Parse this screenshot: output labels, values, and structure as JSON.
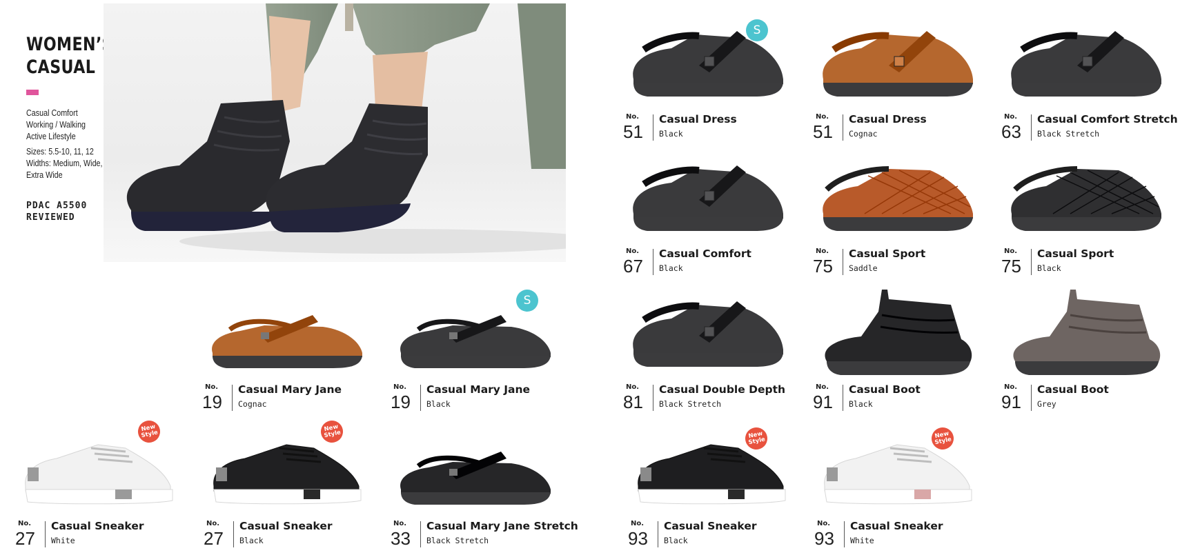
{
  "category": {
    "title_line1": "WOMEN’S",
    "title_line2": "CASUAL",
    "accent_color": "#e0559c",
    "features": [
      "Casual Comfort",
      "Working / Walking",
      "Active Lifestyle"
    ],
    "sizes": "Sizes: 5.5-10, 11, 12",
    "widths_line1": "Widths: Medium, Wide,",
    "widths_line2": "Extra Wide",
    "certification_line1": "PDAC A5500",
    "certification_line2": "REVIEWED"
  },
  "hero": {
    "subject": "black-casual-boots-worn-image",
    "pant_color": "#8a9686",
    "boot_color": "#2a2a2e"
  },
  "badge_colors": {
    "s": "#4cc4cf",
    "new": "#e8523e"
  },
  "products": [
    {
      "id": "p51-black",
      "no_label": "No.",
      "number": "51",
      "name": "Casual Dress",
      "color": "Black",
      "shoe_color": "#3a3a3c",
      "style": "strap",
      "badge": "S",
      "badge_text": "S"
    },
    {
      "id": "p51-cognac",
      "no_label": "No.",
      "number": "51",
      "name": "Casual Dress",
      "color": "Cognac",
      "shoe_color": "#b5672e",
      "style": "strap",
      "badge": "",
      "badge_text": ""
    },
    {
      "id": "p63-black",
      "no_label": "No.",
      "number": "63",
      "name": "Casual Comfort Stretch",
      "color": "Black Stretch",
      "shoe_color": "#3a3a3c",
      "style": "strap",
      "badge": "",
      "badge_text": ""
    },
    {
      "id": "p67-black",
      "no_label": "No.",
      "number": "67",
      "name": "Casual Comfort",
      "color": "Black",
      "shoe_color": "#3a3a3c",
      "style": "strap",
      "badge": "",
      "badge_text": ""
    },
    {
      "id": "p75-saddle",
      "no_label": "No.",
      "number": "75",
      "name": "Casual Sport",
      "color": "Saddle",
      "shoe_color": "#b85a2a",
      "style": "quilted",
      "badge": "",
      "badge_text": ""
    },
    {
      "id": "p75-black",
      "no_label": "No.",
      "number": "75",
      "name": "Casual Sport",
      "color": "Black",
      "shoe_color": "#2f2f31",
      "style": "quilted",
      "badge": "",
      "badge_text": ""
    },
    {
      "id": "p19-cognac",
      "no_label": "No.",
      "number": "19",
      "name": "Casual Mary Jane",
      "color": "Cognac",
      "shoe_color": "#b5672e",
      "style": "maryjane",
      "badge": "",
      "badge_text": ""
    },
    {
      "id": "p19-black",
      "no_label": "No.",
      "number": "19",
      "name": "Casual Mary Jane",
      "color": "Black",
      "shoe_color": "#3a3a3c",
      "style": "maryjane",
      "badge": "S",
      "badge_text": "S"
    },
    {
      "id": "p81-black",
      "no_label": "No.",
      "number": "81",
      "name": "Casual Double Depth",
      "color": "Black Stretch",
      "shoe_color": "#3a3a3c",
      "style": "strap",
      "badge": "",
      "badge_text": ""
    },
    {
      "id": "p91-black",
      "no_label": "No.",
      "number": "91",
      "name": "Casual Boot",
      "color": "Black",
      "shoe_color": "#262628",
      "style": "boot",
      "badge": "",
      "badge_text": ""
    },
    {
      "id": "p91-grey",
      "no_label": "No.",
      "number": "91",
      "name": "Casual Boot",
      "color": "Grey",
      "shoe_color": "#6e6562",
      "style": "boot",
      "badge": "",
      "badge_text": ""
    },
    {
      "id": "p27-white",
      "no_label": "No.",
      "number": "27",
      "name": "Casual Sneaker",
      "color": "White",
      "shoe_color": "#f2f2f2",
      "style": "sneaker",
      "badge": "NEW",
      "badge_text": "New Style"
    },
    {
      "id": "p27-black",
      "no_label": "No.",
      "number": "27",
      "name": "Casual Sneaker",
      "color": "Black",
      "shoe_color": "#202022",
      "style": "sneaker",
      "badge": "NEW",
      "badge_text": "New Style"
    },
    {
      "id": "p33-black",
      "no_label": "No.",
      "number": "33",
      "name": "Casual Mary Jane Stretch",
      "color": "Black Stretch",
      "shoe_color": "#262628",
      "style": "maryjane",
      "badge": "",
      "badge_text": ""
    },
    {
      "id": "p93-black",
      "no_label": "No.",
      "number": "93",
      "name": "Casual Sneaker",
      "color": "Black",
      "shoe_color": "#1e1e20",
      "style": "sneaker2",
      "badge": "NEW",
      "badge_text": "New Style"
    },
    {
      "id": "p93-white",
      "no_label": "No.",
      "number": "93",
      "name": "Casual Sneaker",
      "color": "White",
      "shoe_color": "#f2f2f2",
      "style": "sneaker2",
      "badge": "NEW",
      "badge_text": "New Style"
    }
  ]
}
